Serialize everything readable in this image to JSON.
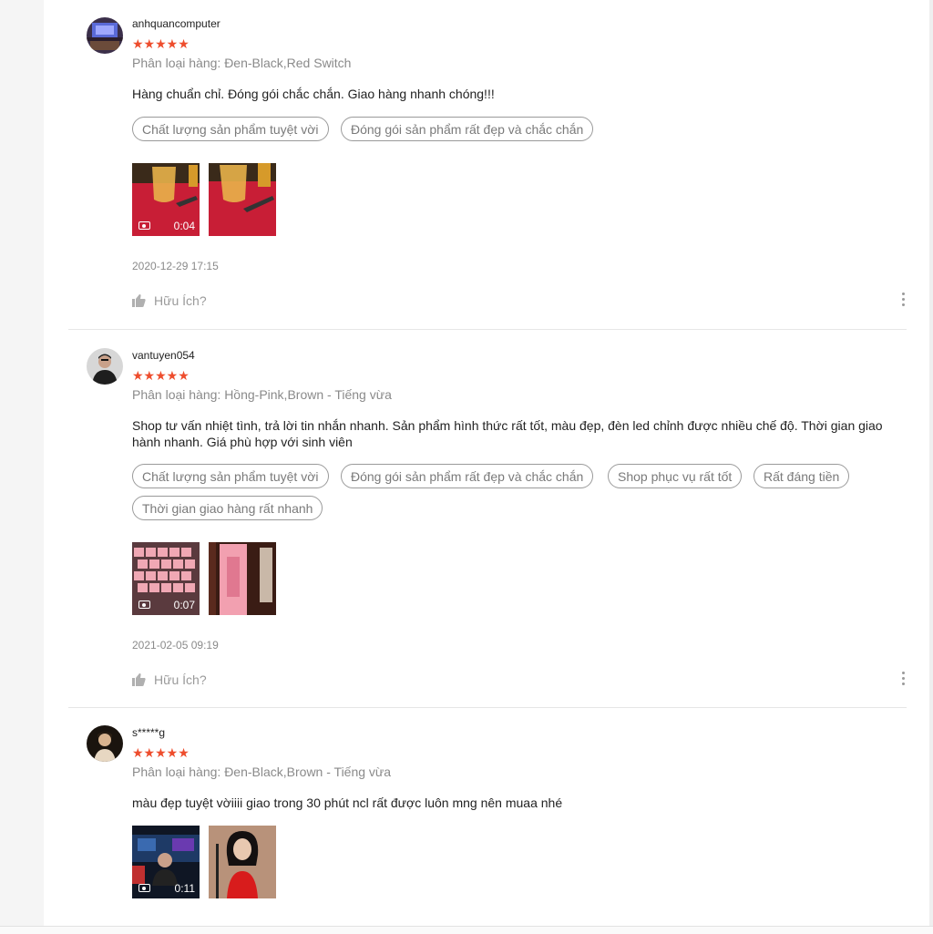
{
  "reviews": [
    {
      "username": "anhquancomputer",
      "stars": "★★★★★",
      "variant": "Phân loại hàng: Đen-Black,Red Switch",
      "comment": "Hàng chuẩn chỉ. Đóng gói chắc chắn. Giao hàng nhanh chóng!!!",
      "tags": [
        "Chất lượng sản phẩm tuyệt vời",
        "Đóng gói sản phẩm rất đẹp và chắc chắn"
      ],
      "video_duration": "0:04",
      "date": "2020-12-29 17:15",
      "helpful": "Hữu Ích?"
    },
    {
      "username": "vantuyen054",
      "stars": "★★★★★",
      "variant": "Phân loại hàng: Hồng-Pink,Brown - Tiếng vừa",
      "comment": "Shop tư vấn nhiệt tình, trả lời tin nhắn nhanh. Sản phẩm hình thức rất tốt, màu đẹp, đèn led chỉnh được nhiều chế độ. Thời gian giao hành nhanh. Giá phù hợp với sinh viên",
      "tags": [
        "Chất lượng sản phẩm tuyệt vời",
        "Đóng gói sản phẩm rất đẹp và chắc chắn",
        "Shop phục vụ rất tốt",
        "Rất đáng tiền",
        "Thời gian giao hàng rất nhanh"
      ],
      "video_duration": "0:07",
      "date": "2021-02-05 09:19",
      "helpful": "Hữu Ích?"
    },
    {
      "username": "s*****g",
      "stars": "★★★★★",
      "variant": "Phân loại hàng: Đen-Black,Brown - Tiếng vừa",
      "comment": "màu đẹp tuyệt vờiiii giao trong 30 phút ncl rất được luôn mng nên muaa nhé",
      "video_duration": "0:11"
    }
  ],
  "colors": {
    "star": "#ee4d2d",
    "tag_border": "#9a9a9a",
    "muted_text": "#8a8a8a"
  }
}
